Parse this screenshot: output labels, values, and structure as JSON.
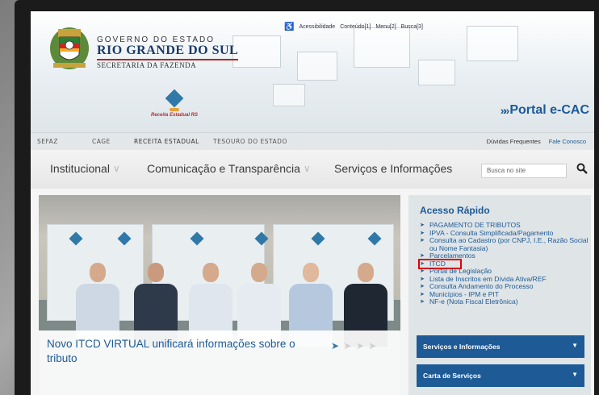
{
  "topbar": {
    "accessibility_icon": "wheelchair-icon",
    "links": [
      "Acessibilidade",
      "Conteúdo[1]",
      "Menu[2]",
      "Busca[3]"
    ]
  },
  "header": {
    "gov_top": "GOVERNO DO ESTADO",
    "gov_main": "RIO GRANDE DO SUL",
    "secretaria": "SECRETARIA DA FAZENDA",
    "receita_label": "Receita Estadual RS",
    "portal_label": "Portal e-CAC"
  },
  "nav1": {
    "items": [
      "SEFAZ",
      "CAGE",
      "RECEITA ESTADUAL",
      "TESOURO DO ESTADO"
    ],
    "right": [
      "Dúvidas Frequentes",
      "Fale Conosco"
    ]
  },
  "nav2": {
    "menus": [
      "Institucional",
      "Comunicação e Transparência",
      "Serviços e Informações"
    ],
    "search_placeholder": "Busca no site"
  },
  "hero": {
    "caption": "Novo ITCD VIRTUAL unificará informações sobre o tributo"
  },
  "acesso_rapido": {
    "title": "Acesso Rápido",
    "items": [
      "PAGAMENTO DE TRIBUTOS",
      "IPVA - Consulta Simplificada/Pagamento",
      "Consulta ao Cadastro (por CNPJ, I.E., Razão Social ou Nome Fantasia)",
      "Parcelamentos",
      "ITCD",
      "Portal de Legislação",
      "Lista de Inscritos em Dívida Ativa/REF",
      "Consulta Andamento do Processo",
      "Municípios - IPM e PIT",
      "NF-e (Nota Fiscal Eletrônica)"
    ],
    "buttons": [
      "Serviços e Informações",
      "Carta de Serviços"
    ]
  },
  "colors": {
    "brand_blue": "#1d5a96",
    "highlight_red": "#e00000"
  }
}
